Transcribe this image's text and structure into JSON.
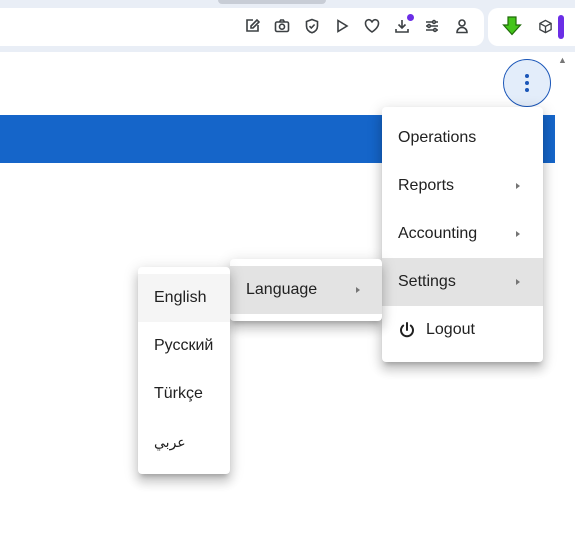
{
  "browser": {
    "toolbar_icons": [
      "edit-icon",
      "camera-icon",
      "shield-check-icon",
      "play-icon",
      "heart-icon",
      "download-icon",
      "sliders-icon",
      "user-icon"
    ],
    "extensions": [
      "green-down-arrow-icon",
      "cube-icon"
    ],
    "accent": "#6b2ee6"
  },
  "page": {
    "band_color": "#1565c9",
    "kebab_label": "More options"
  },
  "menu": {
    "items": [
      {
        "label": "Operations",
        "has_submenu": false
      },
      {
        "label": "Reports",
        "has_submenu": true
      },
      {
        "label": "Accounting",
        "has_submenu": true
      },
      {
        "label": "Settings",
        "has_submenu": true,
        "active": true
      },
      {
        "label": "Logout",
        "icon": "power-icon"
      }
    ]
  },
  "settings_submenu": {
    "items": [
      {
        "label": "Language",
        "has_submenu": true,
        "active": true
      }
    ]
  },
  "language_submenu": {
    "items": [
      {
        "label": "English",
        "hovered": true
      },
      {
        "label": "Русский"
      },
      {
        "label": "Türkçe"
      },
      {
        "label": "عربي"
      }
    ]
  }
}
